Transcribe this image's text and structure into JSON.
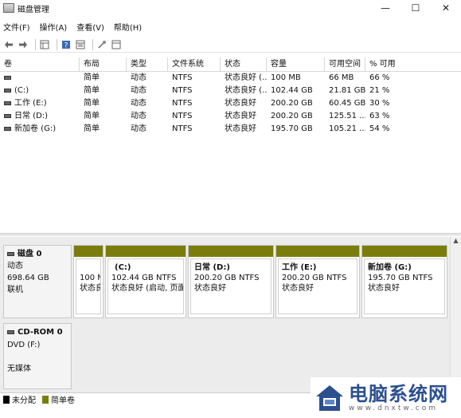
{
  "window": {
    "title": "磁盘管理",
    "minimize": "—",
    "maximize": "☐",
    "close": "✕"
  },
  "menu": [
    "文件(F)",
    "操作(A)",
    "查看(V)",
    "帮助(H)"
  ],
  "toolbar_icons": [
    "back-icon",
    "forward-icon",
    "grid-icon",
    "help-icon",
    "properties-icon",
    "wizard-icon",
    "window-icon"
  ],
  "volume_table": {
    "headers": [
      "卷",
      "布局",
      "类型",
      "文件系统",
      "状态",
      "容量",
      "可用空间",
      "% 可用"
    ],
    "rows": [
      [
        "",
        "简单",
        "动态",
        "NTFS",
        "状态良好 (...",
        "100 MB",
        "66 MB",
        "66 %"
      ],
      [
        "(C:)",
        "简单",
        "动态",
        "NTFS",
        "状态良好 (...",
        "102.44 GB",
        "21.81 GB",
        "21 %"
      ],
      [
        "工作 (E:)",
        "简单",
        "动态",
        "NTFS",
        "状态良好",
        "200.20 GB",
        "60.45 GB",
        "30 %"
      ],
      [
        "日常 (D:)",
        "简单",
        "动态",
        "NTFS",
        "状态良好",
        "200.20 GB",
        "125.51 ...",
        "63 %"
      ],
      [
        "新加卷 (G:)",
        "简单",
        "动态",
        "NTFS",
        "状态良好",
        "195.70 GB",
        "105.21 ...",
        "54 %"
      ]
    ]
  },
  "disk0": {
    "name": "磁盘 0",
    "type": "动态",
    "size": "698.64 GB",
    "status": "联机",
    "partitions": [
      {
        "name": "",
        "size": "100 M",
        "status": "状态良"
      },
      {
        "name": "(C:)",
        "size": "102.44 GB NTFS",
        "status": "状态良好 (启动, 页面文"
      },
      {
        "name": "日常  (D:)",
        "size": "200.20 GB NTFS",
        "status": "状态良好"
      },
      {
        "name": "工作  (E:)",
        "size": "200.20 GB NTFS",
        "status": "状态良好"
      },
      {
        "name": "新加卷  (G:)",
        "size": "195.70 GB NTFS",
        "status": "状态良好"
      }
    ]
  },
  "cdrom0": {
    "name": "CD-ROM 0",
    "drive": "DVD (F:)",
    "status": "无媒体"
  },
  "legend": [
    {
      "label": "未分配",
      "color": "#000000"
    },
    {
      "label": "简单卷",
      "color": "#7a7d0c"
    }
  ],
  "watermark": {
    "main": "电脑系统网",
    "url": "www.dnxtw.com"
  }
}
